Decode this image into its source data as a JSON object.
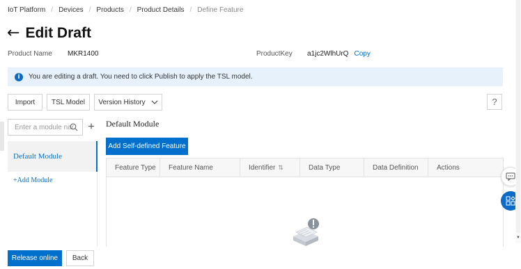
{
  "breadcrumb": [
    "IoT Platform",
    "Devices",
    "Products",
    "Product Details",
    "Define Feature"
  ],
  "header": {
    "back_icon": "back-arrow-icon",
    "title": "Edit Draft"
  },
  "product": {
    "name_label": "Product Name",
    "name_value": "MKR1400",
    "key_label": "ProductKey",
    "key_value": "a1jc2WlhUrQ",
    "copy_label": "Copy"
  },
  "alert": {
    "icon": "info-icon",
    "text": "You are editing a draft. You need to click Publish to apply the TSL model."
  },
  "toolbar": {
    "import_label": "Import",
    "tsl_label": "TSL Model",
    "version_label": "Version History",
    "help_label": "?"
  },
  "modules": {
    "search_placeholder": "Enter a module nar",
    "add_icon": "+",
    "items": [
      {
        "label": "Default Module"
      }
    ],
    "add_module_label": "+Add Module"
  },
  "main": {
    "section_title": "Default Module",
    "add_feature_label": "Add Self-defined Feature",
    "columns": [
      "Feature Type",
      "Feature Name",
      "Identifier",
      "Data Type",
      "Data Definition",
      "Actions"
    ]
  },
  "footer": {
    "release_label": "Release online",
    "back_label": "Back"
  },
  "colors": {
    "accent": "#0070cc",
    "alert_bg": "#e6f1fb"
  }
}
